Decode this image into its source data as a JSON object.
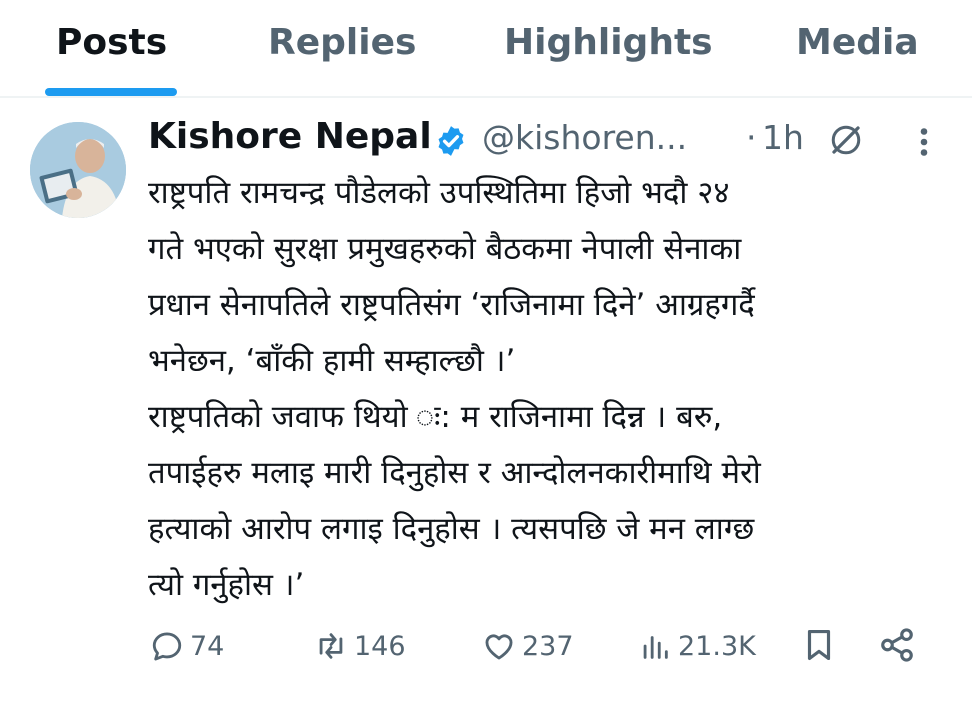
{
  "tabs": [
    {
      "label": "Posts",
      "active": true
    },
    {
      "label": "Replies",
      "active": false
    },
    {
      "label": "Highlights",
      "active": false
    },
    {
      "label": "Media",
      "active": false
    }
  ],
  "post": {
    "author": {
      "name": "Kishore Nepal",
      "handle": "@kishoren...",
      "verified": true
    },
    "separator": "·",
    "time": "1h",
    "text_lines": [
      "राष्ट्रपति रामचन्द्र पौडेलको उपस्थितिमा हिजो भदौ २४",
      "गते भएको सुरक्षा प्रमुखहरुको बैठकमा नेपाली सेनाका",
      "प्रधान सेनापतिले राष्ट्रपतिसंग ‘राजिनामा दिने’ आग्रहगर्दै",
      "भनेछन, ‘बाँकी हामी सम्हाल्छौ ।’",
      "राष्ट्रपतिको जवाफ थियो ः: म राजिनामा दिन्न । बरु,",
      "तपाईहरु मलाइ मारी दिनुहोस र आन्दोलनकारीमाथि मेरो",
      "हत्याको आरोप लगाइ दिनुहोस । त्यसपछि जे मन लाग्छ",
      "त्यो गर्नुहोस ।’"
    ],
    "stats": {
      "replies": "74",
      "reposts": "146",
      "likes": "237",
      "views": "21.3K"
    }
  },
  "colors": {
    "accent": "#1d9bf0",
    "text": "#0f1419",
    "muted": "#536471",
    "divider": "#eff3f4"
  },
  "icons": [
    "verified-badge-icon",
    "grok-icon",
    "more-icon",
    "reply-icon",
    "repost-icon",
    "like-icon",
    "views-icon",
    "bookmark-icon",
    "share-icon"
  ]
}
